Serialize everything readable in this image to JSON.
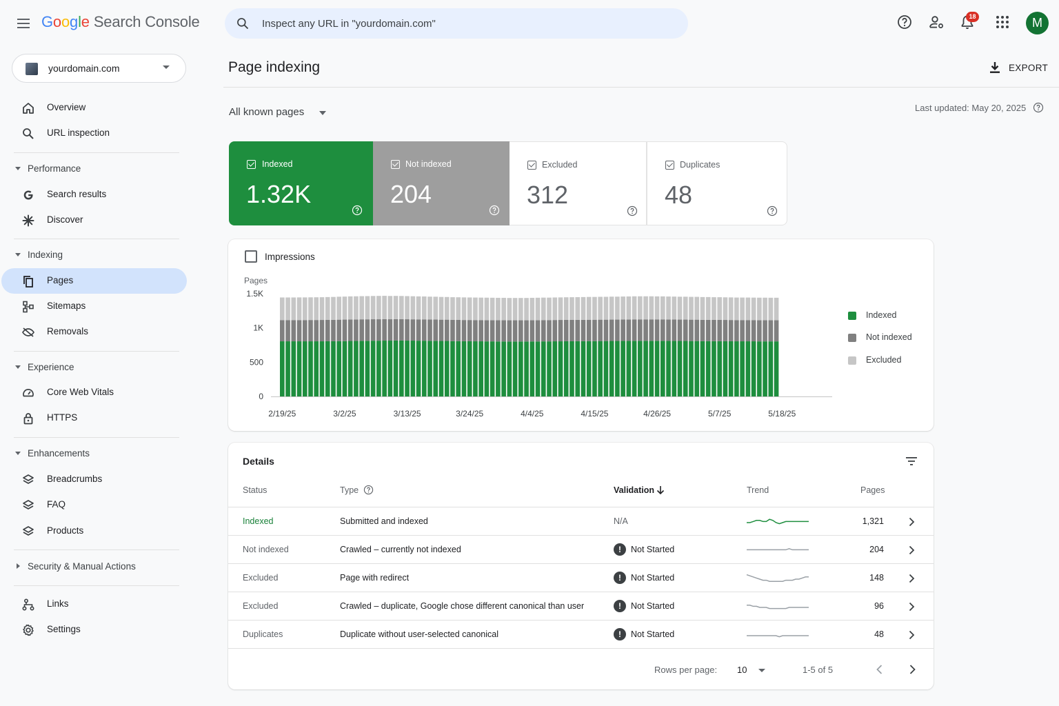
{
  "app": {
    "logo_google": [
      "G",
      "o",
      "o",
      "g",
      "l",
      "e"
    ],
    "product": "Search Console",
    "search_placeholder": "Inspect any URL in \"yourdomain.com\"",
    "notification_count": "18",
    "avatar_letter": "M"
  },
  "sidebar": {
    "property": "yourdomain.com",
    "items": {
      "overview": "Overview",
      "url_inspection": "URL inspection",
      "performance": "Performance",
      "search_results": "Search results",
      "discover": "Discover",
      "indexing": "Indexing",
      "pages": "Pages",
      "sitemaps": "Sitemaps",
      "removals": "Removals",
      "experience": "Experience",
      "core_web_vitals": "Core Web Vitals",
      "https": "HTTPS",
      "enhancements": "Enhancements",
      "breadcrumbs": "Breadcrumbs",
      "faq": "FAQ",
      "products": "Products",
      "security": "Security & Manual Actions",
      "links": "Links",
      "settings": "Settings"
    }
  },
  "header": {
    "title": "Page indexing",
    "export_label": "EXPORT",
    "filter": "All known pages",
    "last_updated": "Last updated: May 20, 2025"
  },
  "cards": [
    {
      "label": "Indexed",
      "value": "1.32K"
    },
    {
      "label": "Not indexed",
      "value": "204"
    },
    {
      "label": "Excluded",
      "value": "312"
    },
    {
      "label": "Duplicates",
      "value": "48"
    }
  ],
  "impressions_label": "Impressions",
  "chart_data": {
    "type": "bar",
    "stacked": true,
    "ylabel": "Pages",
    "ylim": [
      0,
      1500
    ],
    "y_ticks": [
      "0",
      "500",
      "1K",
      "1.5K"
    ],
    "x_tick_labels": [
      "2/19/25",
      "3/2/25",
      "3/13/25",
      "3/24/25",
      "4/4/25",
      "4/15/25",
      "4/26/25",
      "5/7/25",
      "5/18/25"
    ],
    "x_tick_positions": [
      0,
      11,
      22,
      33,
      44,
      55,
      66,
      77,
      88
    ],
    "legend": "right",
    "series": [
      {
        "name": "Indexed",
        "color": "#1e8e3e",
        "values": [
          805,
          805,
          805,
          805,
          805,
          805,
          805,
          805,
          806,
          806,
          808,
          808,
          810,
          810,
          812,
          812,
          814,
          814,
          815,
          815,
          816,
          816,
          815,
          815,
          814,
          814,
          812,
          812,
          810,
          810,
          808,
          808,
          806,
          806,
          805,
          805,
          804,
          804,
          803,
          803,
          802,
          802,
          802,
          802,
          803,
          803,
          804,
          804,
          805,
          805,
          806,
          806,
          807,
          807,
          808,
          808,
          809,
          809,
          810,
          810,
          811,
          811,
          812,
          812,
          812,
          812,
          812,
          812,
          811,
          811,
          810,
          810,
          809,
          809,
          808,
          808,
          807,
          807,
          806,
          806,
          805,
          805,
          805,
          805,
          804,
          804,
          804,
          804
        ]
      },
      {
        "name": "Not indexed",
        "color": "#808080",
        "values": [
          310,
          310,
          310,
          310,
          310,
          311,
          311,
          312,
          312,
          313,
          313,
          314,
          314,
          314,
          314,
          314,
          313,
          313,
          313,
          312,
          312,
          312,
          312,
          311,
          311,
          311,
          311,
          311,
          311,
          311,
          310,
          310,
          310,
          310,
          310,
          310,
          310,
          310,
          310,
          310,
          310,
          310,
          310,
          310,
          310,
          311,
          311,
          311,
          311,
          312,
          312,
          312,
          312,
          312,
          312,
          312,
          312,
          312,
          312,
          312,
          312,
          313,
          313,
          313,
          313,
          313,
          313,
          313,
          313,
          312,
          312,
          312,
          312,
          312,
          311,
          311,
          311,
          311,
          311,
          310,
          310,
          310,
          310,
          310,
          310,
          310,
          310,
          310
        ]
      },
      {
        "name": "Excluded",
        "color": "#c6c6c6",
        "values": [
          330,
          330,
          330,
          331,
          331,
          331,
          332,
          332,
          333,
          334,
          335,
          336,
          337,
          338,
          338,
          339,
          340,
          341,
          341,
          340,
          340,
          339,
          338,
          337,
          336,
          335,
          334,
          333,
          332,
          331,
          331,
          330,
          330,
          329,
          329,
          328,
          328,
          327,
          327,
          327,
          326,
          326,
          326,
          326,
          327,
          327,
          328,
          328,
          329,
          329,
          330,
          331,
          331,
          332,
          333,
          333,
          334,
          334,
          335,
          335,
          336,
          336,
          337,
          337,
          337,
          337,
          336,
          336,
          335,
          335,
          334,
          334,
          333,
          333,
          332,
          332,
          331,
          331,
          330,
          330,
          329,
          329,
          329,
          328,
          328,
          328,
          327,
          327
        ]
      }
    ]
  },
  "details": {
    "title": "Details",
    "columns": {
      "status": "Status",
      "type": "Type",
      "validation": "Validation",
      "trend": "Trend",
      "pages": "Pages"
    },
    "rows": [
      {
        "status": "Indexed",
        "type": "Submitted and indexed",
        "validation": "N/A",
        "pages": "1,321",
        "trend_color": "#1e8e3e",
        "trend": [
          5,
          5,
          6,
          7,
          7,
          6,
          6,
          8,
          7,
          5,
          4,
          5,
          6,
          6,
          6,
          6,
          6,
          6,
          6,
          6
        ]
      },
      {
        "status": "Not indexed",
        "type": "Crawled – currently not indexed",
        "validation": "Not Started",
        "pages": "204",
        "trend_color": "#9aa0a6",
        "trend": [
          6,
          6,
          6,
          6,
          6,
          6,
          6,
          6,
          6,
          6,
          6,
          6,
          6,
          7,
          6,
          6,
          6,
          6,
          6,
          6
        ]
      },
      {
        "status": "Excluded",
        "type": "Page with redirect",
        "validation": "Not Started",
        "pages": "148",
        "trend_color": "#9aa0a6",
        "trend": [
          9,
          8,
          7,
          6,
          5,
          4,
          4,
          3,
          3,
          3,
          3,
          3,
          4,
          4,
          4,
          5,
          5,
          6,
          7,
          7
        ]
      },
      {
        "status": "Excluded",
        "type": "Crawled – duplicate, Google chose different canonical than user",
        "validation": "Not Started",
        "pages": "96",
        "trend_color": "#9aa0a6",
        "trend": [
          7,
          7,
          6,
          6,
          5,
          5,
          5,
          4,
          4,
          4,
          4,
          4,
          4,
          5,
          5,
          5,
          5,
          5,
          5,
          5
        ]
      },
      {
        "status": "Duplicates",
        "type": "Duplicate without user-selected canonical",
        "validation": "Not Started",
        "pages": "48",
        "trend_color": "#9aa0a6",
        "trend": [
          5,
          5,
          5,
          5,
          5,
          5,
          5,
          5,
          5,
          5,
          4,
          5,
          5,
          5,
          5,
          5,
          5,
          5,
          5,
          5
        ]
      }
    ],
    "rows_per_page_label": "Rows per page:",
    "rows_per_page": "10",
    "range": "1-5 of 5"
  }
}
